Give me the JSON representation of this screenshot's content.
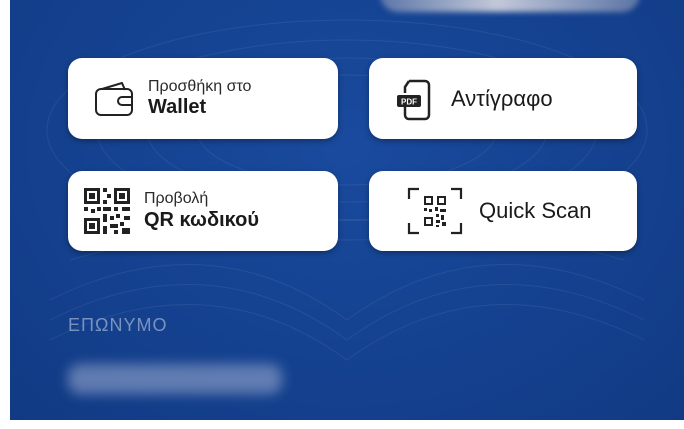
{
  "actions": {
    "wallet": {
      "line1": "Προσθήκη στο",
      "line2": "Wallet",
      "icon": "wallet-icon"
    },
    "copy": {
      "label": "Αντίγραφο",
      "icon": "pdf-document-icon",
      "icon_text": "PDF"
    },
    "qr": {
      "line1": "Προβολή",
      "line2": "QR κωδικού",
      "icon": "qr-code-icon"
    },
    "scan": {
      "label": "Quick Scan",
      "icon": "qr-scan-icon"
    }
  },
  "fields": {
    "surname_label": "ΕΠΩΝΥΜΟ"
  },
  "colors": {
    "background": "#154392",
    "card": "#ffffff",
    "text": "#1a1a1a",
    "label_muted": "#afbedc"
  }
}
